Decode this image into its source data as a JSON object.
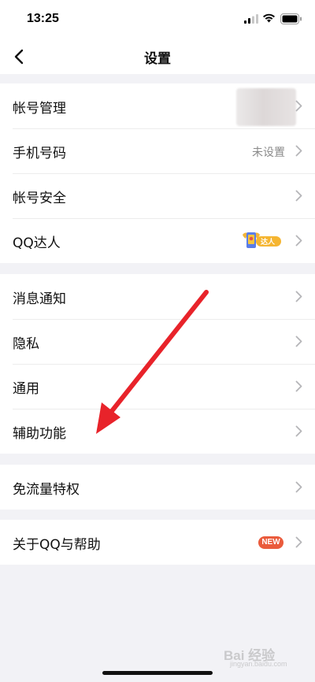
{
  "status_bar": {
    "time": "13:25"
  },
  "nav": {
    "title": "设置"
  },
  "groups": [
    {
      "items": [
        {
          "label": "帐号管理"
        },
        {
          "label": "手机号码",
          "value": "未设置"
        },
        {
          "label": "帐号安全"
        },
        {
          "label": "QQ达人"
        }
      ]
    },
    {
      "items": [
        {
          "label": "消息通知"
        },
        {
          "label": "隐私"
        },
        {
          "label": "通用"
        },
        {
          "label": "辅助功能"
        }
      ]
    },
    {
      "items": [
        {
          "label": "免流量特权"
        }
      ]
    },
    {
      "items": [
        {
          "label": "关于QQ与帮助",
          "badge": "NEW"
        }
      ]
    }
  ],
  "daren_badge_text": "达人",
  "annotation": {
    "arrow_color": "#e8232a",
    "points_to": "辅助功能"
  },
  "watermark": {
    "text": "Bai 经验",
    "sub": "jingyan.baidu.com"
  },
  "colors": {
    "background": "#f2f2f6",
    "badge": "#ea5b3c",
    "chevron": "#b5b5b8",
    "secondary_text": "#8a8a8a"
  }
}
